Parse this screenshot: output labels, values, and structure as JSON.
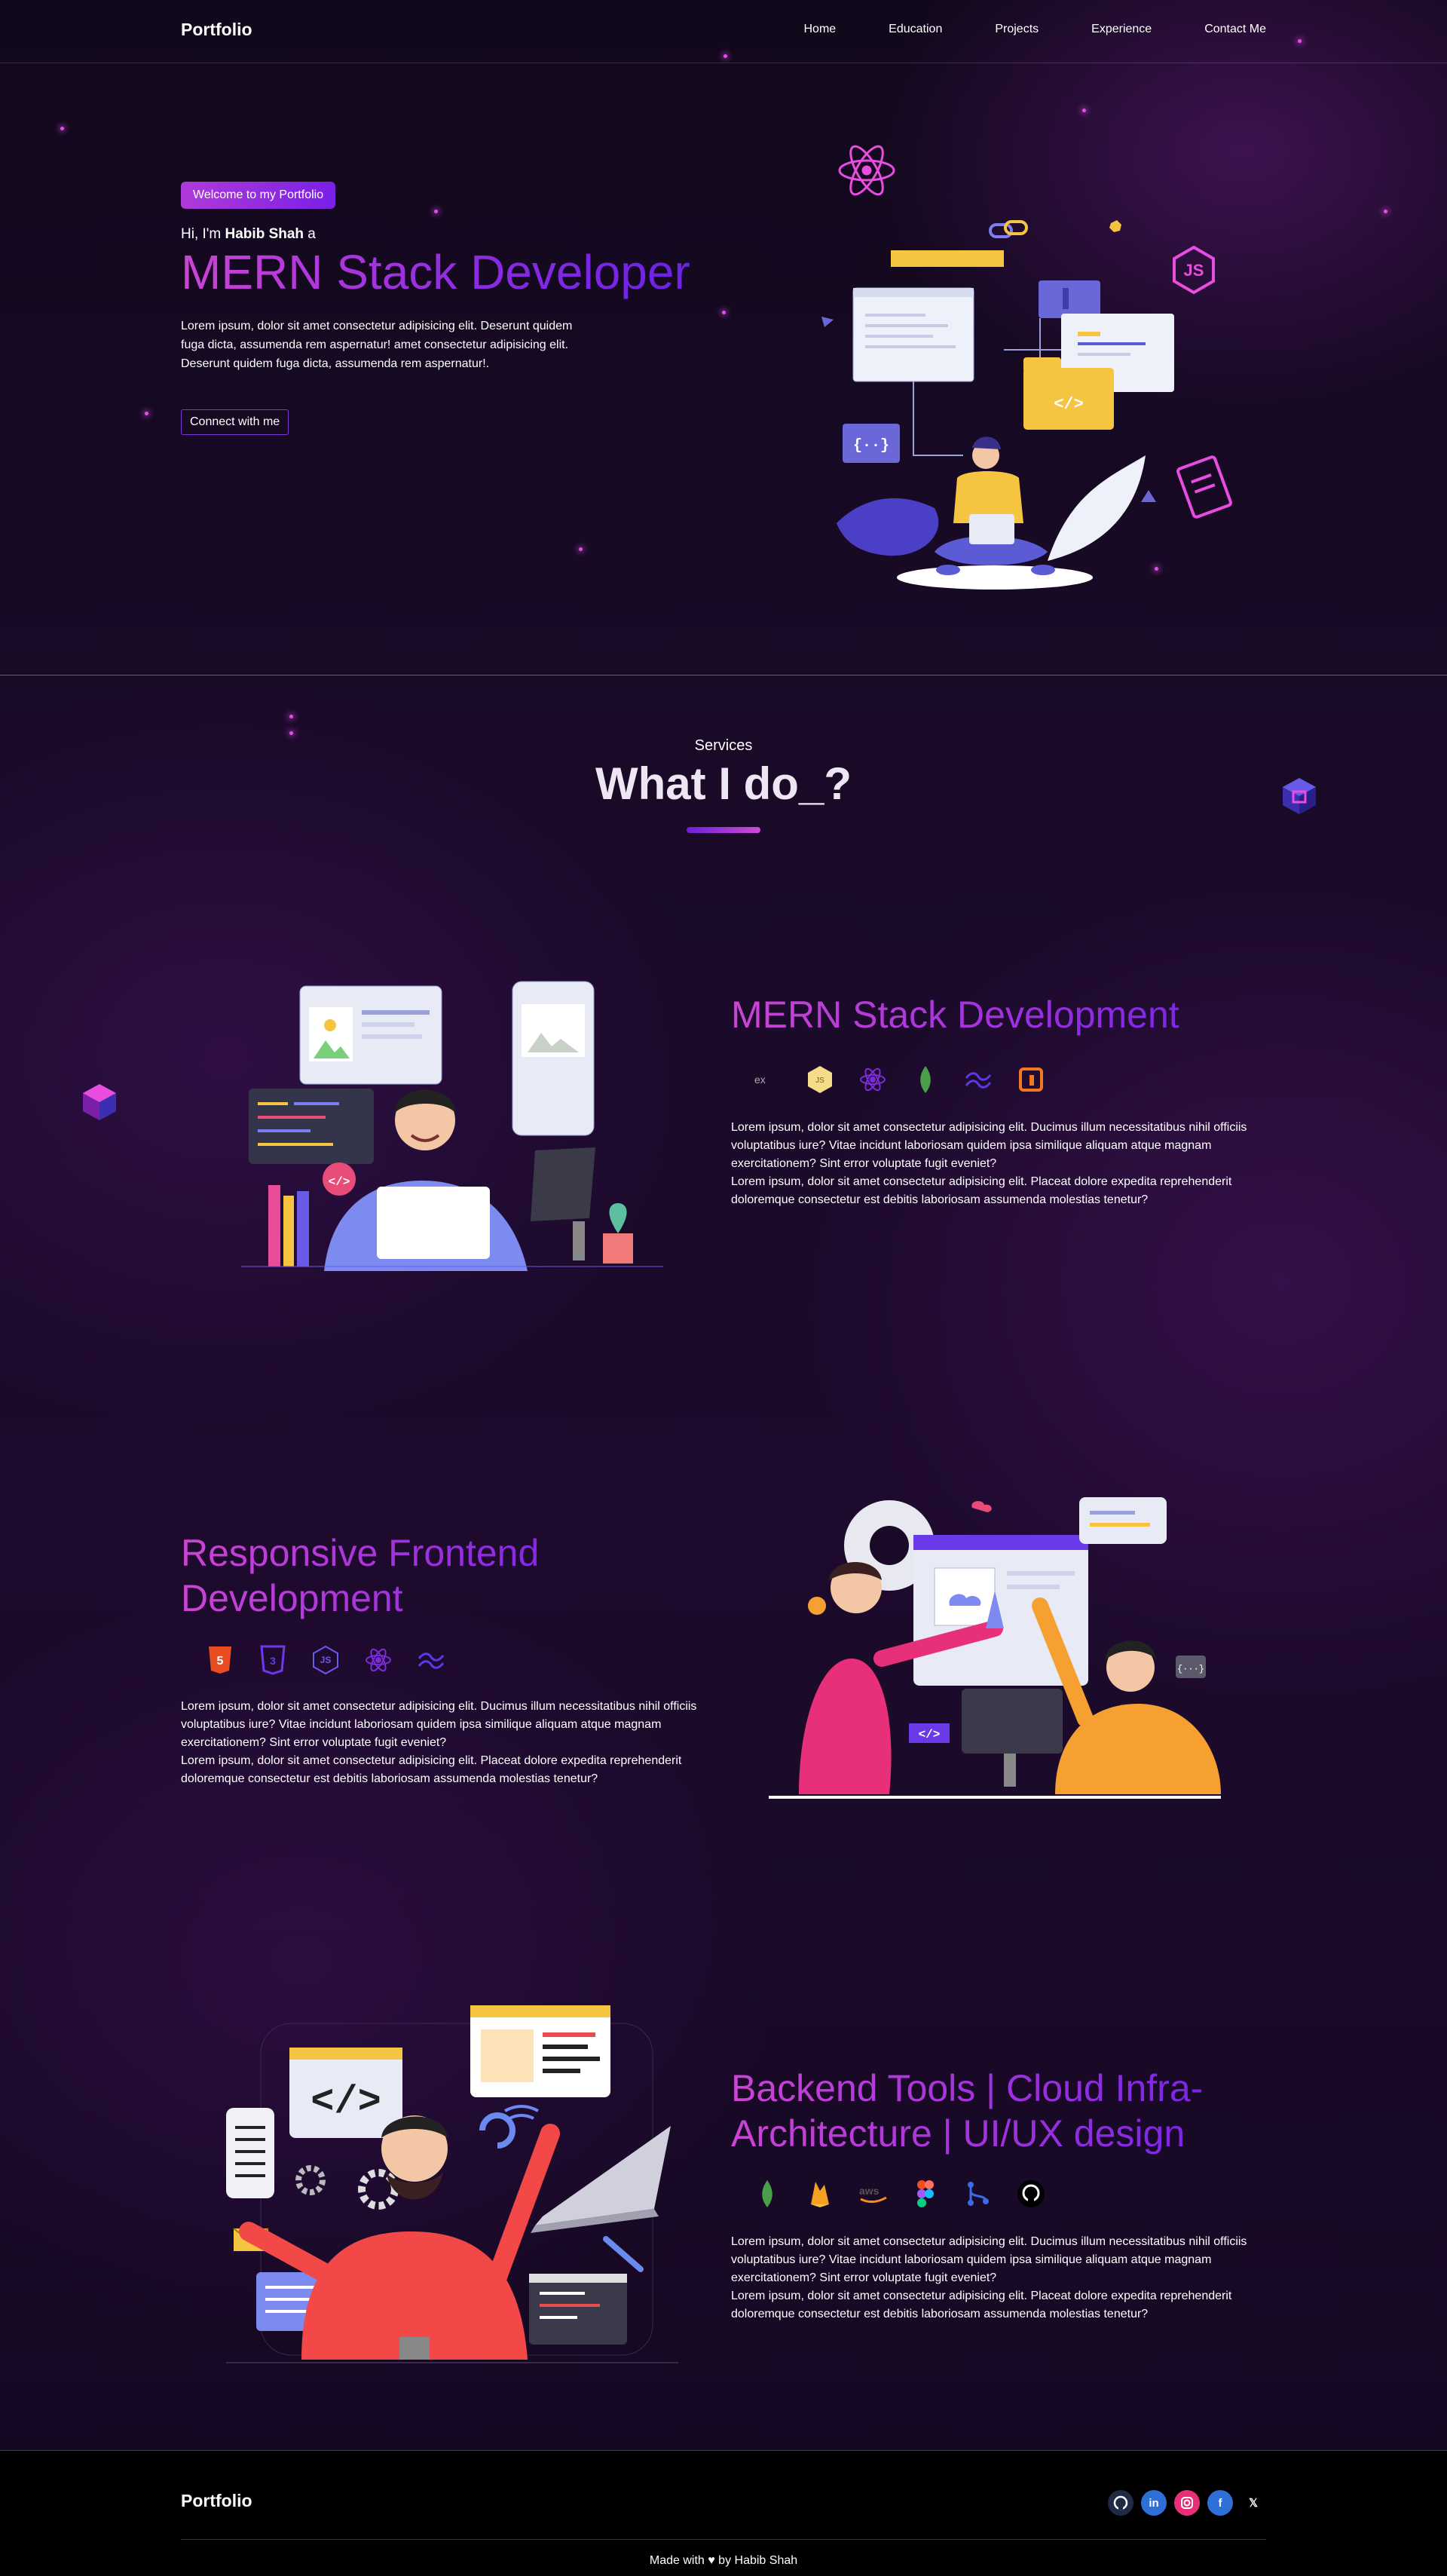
{
  "nav": {
    "brand": "Portfolio",
    "links": [
      "Home",
      "Education",
      "Projects",
      "Experience",
      "Contact Me"
    ]
  },
  "hero": {
    "badge": "Welcome to my Portfolio",
    "greeting_prefix": "Hi, I'm ",
    "name": "Habib Shah",
    "greeting_suffix": " a",
    "title": "MERN Stack Developer",
    "description": "Lorem ipsum, dolor sit amet consectetur adipisicing elit. Deserunt quidem fuga dicta, assumenda rem aspernatur! amet consectetur adipisicing elit. Deserunt quidem fuga dicta, assumenda rem aspernatur!.",
    "cta": "Connect with me"
  },
  "services": {
    "subtitle": "Services",
    "title": "What I do_?",
    "items": [
      {
        "title": "MERN Stack Development",
        "icons": [
          "express-icon",
          "nodejs-icon",
          "react-icon",
          "mongodb-icon",
          "tailwind-icon",
          "aws-amplify-icon"
        ],
        "description": "Lorem ipsum, dolor sit amet consectetur adipisicing elit. Ducimus illum necessitatibus nihil officiis voluptatibus iure? Vitae incidunt laboriosam quidem ipsa similique aliquam atque magnam exercitationem? Sint error voluptate fugit eveniet?\nLorem ipsum, dolor sit amet consectetur adipisicing elit. Placeat dolore expedita reprehenderit doloremque consectetur est debitis laboriosam assumenda molestias tenetur?"
      },
      {
        "title": "Responsive Frontend Development",
        "icons": [
          "html5-icon",
          "css3-icon",
          "javascript-icon",
          "react-icon",
          "tailwind-icon"
        ],
        "description": "Lorem ipsum, dolor sit amet consectetur adipisicing elit. Ducimus illum necessitatibus nihil officiis voluptatibus iure? Vitae incidunt laboriosam quidem ipsa similique aliquam atque magnam exercitationem? Sint error voluptate fugit eveniet?\nLorem ipsum, dolor sit amet consectetur adipisicing elit. Placeat dolore expedita reprehenderit doloremque consectetur est debitis laboriosam assumenda molestias tenetur?"
      },
      {
        "title": "Backend Tools | Cloud Infra-Architecture | UI/UX design",
        "icons": [
          "mongodb-icon",
          "firebase-icon",
          "aws-icon",
          "figma-icon",
          "git-icon",
          "github-icon"
        ],
        "description": "Lorem ipsum, dolor sit amet consectetur adipisicing elit. Ducimus illum necessitatibus nihil officiis voluptatibus iure? Vitae incidunt laboriosam quidem ipsa similique aliquam atque magnam exercitationem? Sint error voluptate fugit eveniet?\nLorem ipsum, dolor sit amet consectetur adipisicing elit. Placeat dolore expedita reprehenderit doloremque consectetur est debitis laboriosam assumenda molestias tenetur?"
      }
    ]
  },
  "footer": {
    "brand": "Portfolio",
    "socials": [
      "github-icon",
      "linkedin-icon",
      "instagram-icon",
      "facebook-icon",
      "x-icon"
    ],
    "made_prefix": "Made with ",
    "made_suffix": " by Habib Shah"
  },
  "colors": {
    "accent_pink": "#cc44d4",
    "accent_purple": "#6b21e8",
    "background": "#12071c",
    "footer_bg": "#000000"
  }
}
